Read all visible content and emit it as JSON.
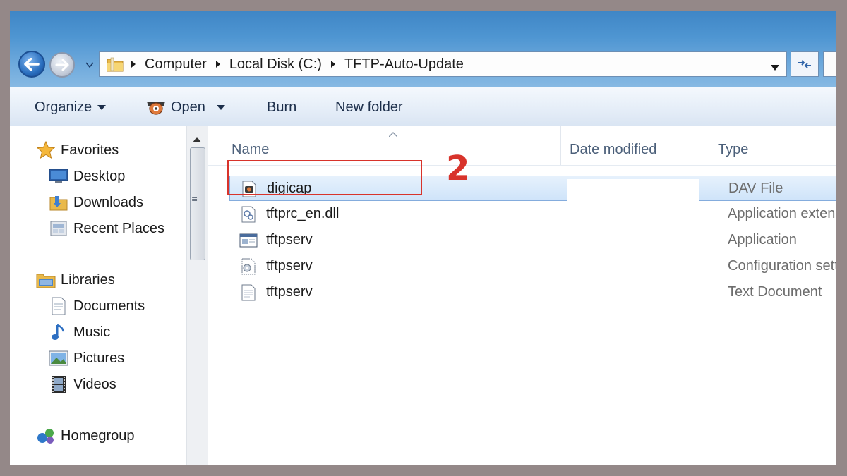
{
  "colors": {
    "frame": "#948888",
    "title_gradient_top": "#3f86c6",
    "accent_red": "#d8332b",
    "selection": "#cfe4fa"
  },
  "address": {
    "crumbs": [
      "Computer",
      "Local Disk (C:)",
      "TFTP-Auto-Update"
    ]
  },
  "toolbar": {
    "organize": "Organize",
    "open": "Open",
    "burn": "Burn",
    "new_folder": "New folder"
  },
  "nav": {
    "favorites": "Favorites",
    "desktop": "Desktop",
    "downloads": "Downloads",
    "recent_places": "Recent Places",
    "libraries": "Libraries",
    "documents": "Documents",
    "music": "Music",
    "pictures": "Pictures",
    "videos": "Videos",
    "homegroup": "Homegroup"
  },
  "columns": {
    "name": "Name",
    "date_modified": "Date modified",
    "type": "Type"
  },
  "files": [
    {
      "name": "digicap",
      "type": "DAV File",
      "icon": "dav-file-icon"
    },
    {
      "name": "tftprc_en.dll",
      "type": "Application extens",
      "icon": "dll-file-icon"
    },
    {
      "name": "tftpserv",
      "type": "Application",
      "icon": "application-icon"
    },
    {
      "name": "tftpserv",
      "type": "Configuration sett",
      "icon": "config-file-icon"
    },
    {
      "name": "tftpserv",
      "type": "Text Document",
      "icon": "text-document-icon"
    }
  ],
  "annotation": {
    "step_number": "2"
  }
}
